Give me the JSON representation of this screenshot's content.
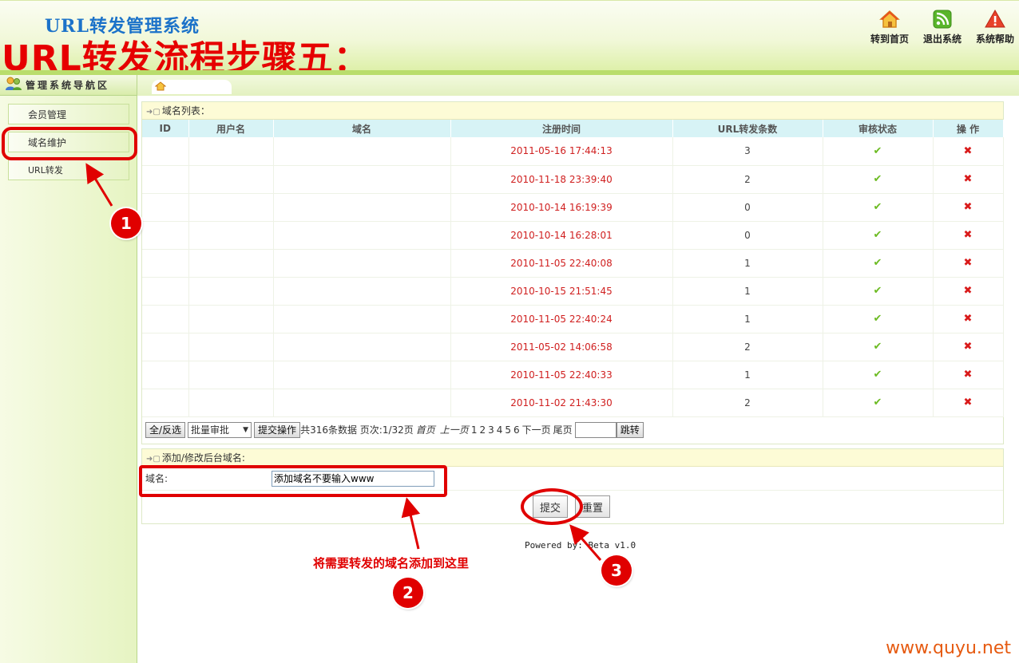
{
  "header": {
    "system_title": "URL转发管理系统",
    "step_title": "URL转发流程步骤五：",
    "links": [
      {
        "label": "转到首页",
        "icon": "home-icon"
      },
      {
        "label": "退出系统",
        "icon": "rss-exit-icon"
      },
      {
        "label": "系统帮助",
        "icon": "warning-help-icon"
      }
    ]
  },
  "sidebar": {
    "title": "管理系统导航区",
    "items": [
      {
        "label": "会员管理"
      },
      {
        "label": "域名维护"
      },
      {
        "label": "URL转发"
      }
    ]
  },
  "domain_list": {
    "title": "域名列表：",
    "columns": [
      "ID",
      "用户名",
      "域名",
      "注册时间",
      "URL转发条数",
      "审核状态",
      "操 作"
    ],
    "rows": [
      {
        "time": "2011-05-16 17:44:13",
        "count": "3"
      },
      {
        "time": "2010-11-18 23:39:40",
        "count": "2"
      },
      {
        "time": "2010-10-14 16:19:39",
        "count": "0"
      },
      {
        "time": "2010-10-14 16:28:01",
        "count": "0"
      },
      {
        "time": "2010-11-05 22:40:08",
        "count": "1"
      },
      {
        "time": "2010-10-15 21:51:45",
        "count": "1"
      },
      {
        "time": "2010-11-05 22:40:24",
        "count": "1"
      },
      {
        "time": "2011-05-02 14:06:58",
        "count": "2"
      },
      {
        "time": "2010-11-05 22:40:33",
        "count": "1"
      },
      {
        "time": "2010-11-02 21:43:30",
        "count": "2"
      }
    ],
    "status_glyph": "✔",
    "delete_glyph": "✖"
  },
  "pager": {
    "select_all": "全/反选",
    "batch_select": "批量审批",
    "submit_op": "提交操作",
    "summary": "共316条数据 页次:1/32页",
    "first": "首页",
    "prev": "上一页",
    "pages": [
      "1",
      "2",
      "3",
      "4",
      "5",
      "6"
    ],
    "next": "下一页",
    "last": "尾页",
    "jump": "跳转"
  },
  "add_form": {
    "title": "添加/修改后台域名:",
    "label": "域名:",
    "value": "添加域名不要输入www",
    "submit": "提交",
    "reset": "重置"
  },
  "footer": {
    "powered": "Powered by:  Beta v1.0"
  },
  "annotations": {
    "badge1": "1",
    "badge2": "2",
    "badge3": "3",
    "note": "将需要转发的域名添加到这里"
  },
  "watermark": "www.quyu.net",
  "colors": {
    "accent_red": "#e00000",
    "title_blue": "#1b72c9",
    "header_green": "#b9dd6c",
    "table_header": "#d7f3f6",
    "time_red": "#d02020"
  }
}
